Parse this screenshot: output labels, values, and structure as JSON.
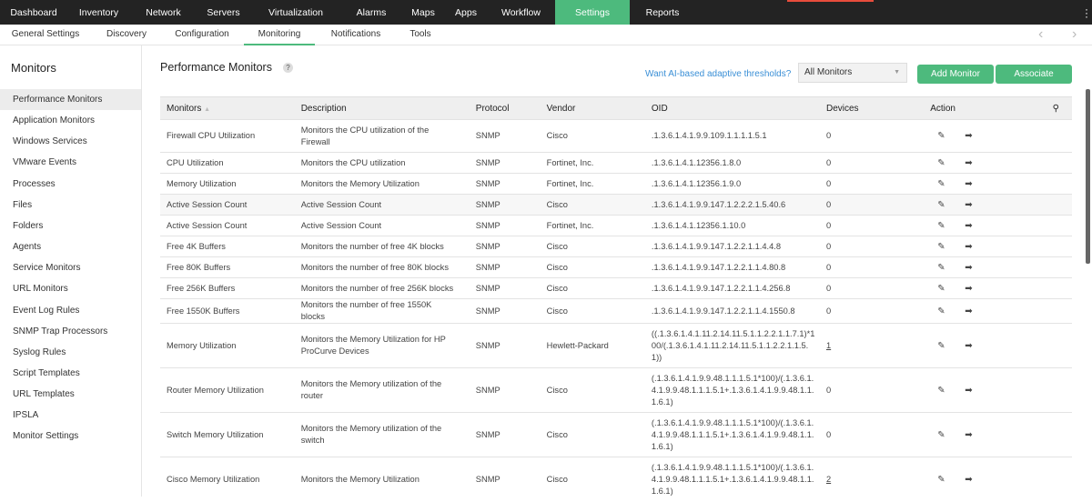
{
  "topnav": {
    "items": [
      "Dashboard",
      "Inventory",
      "Network",
      "Servers",
      "Virtualization",
      "Alarms",
      "Maps",
      "Apps",
      "Workflow",
      "Settings",
      "Reports"
    ],
    "active": "Settings"
  },
  "subnav": {
    "items": [
      "General Settings",
      "Discovery",
      "Configuration",
      "Monitoring",
      "Notifications",
      "Tools"
    ],
    "active": "Monitoring"
  },
  "sidebar": {
    "title": "Monitors",
    "items": [
      "Performance Monitors",
      "Application Monitors",
      "Windows Services",
      "VMware Events",
      "Processes",
      "Files",
      "Folders",
      "Agents",
      "Service Monitors",
      "URL Monitors",
      "Event Log Rules",
      "SNMP Trap Processors",
      "Syslog Rules",
      "Script Templates",
      "URL Templates",
      "IPSLA",
      "Monitor Settings"
    ]
  },
  "main": {
    "title": "Performance Monitors",
    "help": "?",
    "ai_link": "Want AI-based adaptive thresholds?",
    "filter": "All Monitors",
    "add_button": "Add Monitor",
    "associate_button": "Associate"
  },
  "table": {
    "headers": [
      "Monitors",
      "Description",
      "Protocol",
      "Vendor",
      "OID",
      "Devices",
      "Action"
    ],
    "rows": [
      [
        "Firewall CPU Utilization",
        "Monitors the CPU utilization of the Firewall",
        "SNMP",
        "Cisco",
        ".1.3.6.1.4.1.9.9.109.1.1.1.1.5.1",
        "0"
      ],
      [
        "CPU Utilization",
        "Monitors the CPU utilization",
        "SNMP",
        "Fortinet, Inc.",
        ".1.3.6.1.4.1.12356.1.8.0",
        "0"
      ],
      [
        "Memory Utilization",
        "Monitors the Memory Utilization",
        "SNMP",
        "Fortinet, Inc.",
        ".1.3.6.1.4.1.12356.1.9.0",
        "0"
      ],
      [
        "Active Session Count",
        "Active Session Count",
        "SNMP",
        "Cisco",
        ".1.3.6.1.4.1.9.9.147.1.2.2.2.1.5.40.6",
        "0"
      ],
      [
        "Active Session Count",
        "Active Session Count",
        "SNMP",
        "Fortinet, Inc.",
        ".1.3.6.1.4.1.12356.1.10.0",
        "0"
      ],
      [
        "Free 4K Buffers",
        "Monitors the number of free 4K blocks",
        "SNMP",
        "Cisco",
        ".1.3.6.1.4.1.9.9.147.1.2.2.1.1.4.4.8",
        "0"
      ],
      [
        "Free 80K Buffers",
        "Monitors the number of free 80K blocks",
        "SNMP",
        "Cisco",
        ".1.3.6.1.4.1.9.9.147.1.2.2.1.1.4.80.8",
        "0"
      ],
      [
        "Free 256K Buffers",
        "Monitors the number of free 256K blocks",
        "SNMP",
        "Cisco",
        ".1.3.6.1.4.1.9.9.147.1.2.2.1.1.4.256.8",
        "0"
      ],
      [
        "Free 1550K Buffers",
        "Monitors the number of free 1550K blocks",
        "SNMP",
        "Cisco",
        ".1.3.6.1.4.1.9.9.147.1.2.2.1.1.4.1550.8",
        "0"
      ],
      [
        "Memory Utilization",
        "Monitors the Memory Utilization for HP ProCurve Devices",
        "SNMP",
        "Hewlett-Packard",
        "((.1.3.6.1.4.1.11.2.14.11.5.1.1.2.2.1.1.7.1)*100/(.1.3.6.1.4.1.11.2.14.11.5.1.1.2.2.1.1.5.1))",
        "1"
      ],
      [
        "Router Memory Utilization",
        "Monitors the Memory utilization of the router",
        "SNMP",
        "Cisco",
        "(.1.3.6.1.4.1.9.9.48.1.1.1.5.1*100)/(.1.3.6.1.4.1.9.9.48.1.1.1.5.1+.1.3.6.1.4.1.9.9.48.1.1.1.6.1)",
        "0"
      ],
      [
        "Switch Memory Utilization",
        "Monitors the Memory utilization of the switch",
        "SNMP",
        "Cisco",
        "(.1.3.6.1.4.1.9.9.48.1.1.1.5.1*100)/(.1.3.6.1.4.1.9.9.48.1.1.1.5.1+.1.3.6.1.4.1.9.9.48.1.1.1.6.1)",
        "0"
      ],
      [
        "Cisco Memory Utilization",
        "Monitors the Memory Utilization",
        "SNMP",
        "Cisco",
        "(.1.3.6.1.4.1.9.9.48.1.1.1.5.1*100)/(.1.3.6.1.4.1.9.9.48.1.1.1.5.1+.1.3.6.1.4.1.9.9.48.1.1.1.6.1)",
        "2"
      ]
    ]
  },
  "colors": {
    "accent": "#4dba7d",
    "topnav_bg": "#232323",
    "link": "#3a8fd6"
  }
}
